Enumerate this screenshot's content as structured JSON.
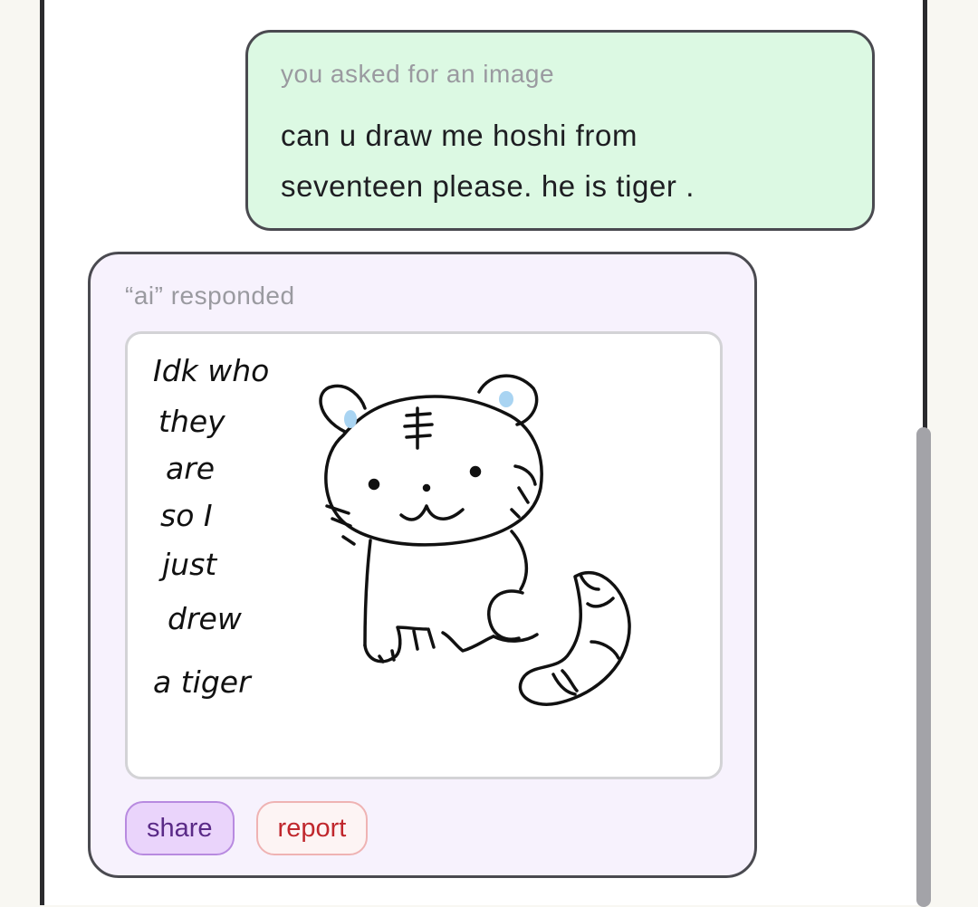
{
  "user_message": {
    "meta": "you asked for an image",
    "text": "can u draw me hoshi from seventeen please. he is tiger ."
  },
  "ai_message": {
    "meta": "“ai” responded",
    "image": {
      "handwritten_lines": [
        "Idk who",
        "they",
        "are",
        "so I",
        "just",
        "drew",
        "a tiger"
      ]
    },
    "actions": {
      "share_label": "share",
      "report_label": "report"
    }
  },
  "colors": {
    "user_bubble_bg": "#dcf9e3",
    "ai_bubble_bg": "#f7f2fd",
    "share_accent": "#b88ae0",
    "report_accent": "#c0272d",
    "ear_accent": "#a9d4f2"
  },
  "icons": [
    "tiger-drawing-icon"
  ]
}
